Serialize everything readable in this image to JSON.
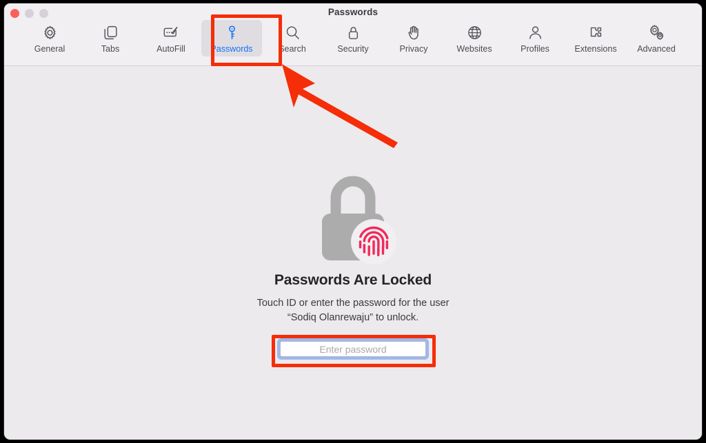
{
  "window": {
    "title": "Passwords",
    "traffic_lights": [
      {
        "name": "close",
        "color": "#FC6058"
      },
      {
        "name": "minimize",
        "color": "#D5D1D6"
      },
      {
        "name": "maximize",
        "color": "#D5D1D6"
      }
    ]
  },
  "toolbar": {
    "items": [
      {
        "label": "General",
        "icon": "gear-icon",
        "selected": false
      },
      {
        "label": "Tabs",
        "icon": "tabs-icon",
        "selected": false
      },
      {
        "label": "AutoFill",
        "icon": "autofill-icon",
        "selected": false
      },
      {
        "label": "Passwords",
        "icon": "key-icon",
        "selected": true
      },
      {
        "label": "Search",
        "icon": "magnifier-icon",
        "selected": false
      },
      {
        "label": "Security",
        "icon": "padlock-icon",
        "selected": false
      },
      {
        "label": "Privacy",
        "icon": "hand-icon",
        "selected": false
      },
      {
        "label": "Websites",
        "icon": "globe-icon",
        "selected": false
      },
      {
        "label": "Profiles",
        "icon": "person-icon",
        "selected": false
      },
      {
        "label": "Extensions",
        "icon": "puzzle-icon",
        "selected": false
      },
      {
        "label": "Advanced",
        "icon": "gears-icon",
        "selected": false
      }
    ],
    "selected_label_color": "#1573F5",
    "label_color": "#4C4951"
  },
  "main": {
    "graphic": "locked-padlock-with-fingerprint-icon",
    "headline": "Passwords Are Locked",
    "subtext_line1": "Touch ID or enter the password for the user",
    "subtext_line2": "“Sodiq Olanrewaju” to unlock.",
    "password_placeholder": "Enter password",
    "password_value": ""
  },
  "annotations": {
    "highlight_color": "#F52D08",
    "boxes": [
      {
        "name": "passwords-tab-highlight"
      },
      {
        "name": "password-input-highlight"
      }
    ],
    "arrow": {
      "name": "pointer-arrow",
      "points_to": "Passwords"
    }
  },
  "colors": {
    "window_background": "#ECEAEC",
    "toolbar_background": "#F2EFF3",
    "accent_blue": "#1573F5",
    "focus_ring": "#9CB8EE",
    "lock_gray": "#ACACAC",
    "fingerprint_red": "#F2295B"
  }
}
